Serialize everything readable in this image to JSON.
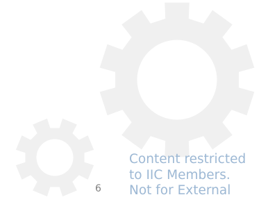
{
  "slide": {
    "page_number": "6",
    "notice_lines": [
      "Content restricted",
      "to IIC Members.",
      "Not for External"
    ]
  },
  "icons": {
    "large_gear": "gear-icon",
    "small_gear": "gear-icon"
  },
  "colors": {
    "background": "#ffffff",
    "gear": "#f0f0f0",
    "notice_text": "#9db8d4",
    "page_number": "#7f7f7f"
  }
}
